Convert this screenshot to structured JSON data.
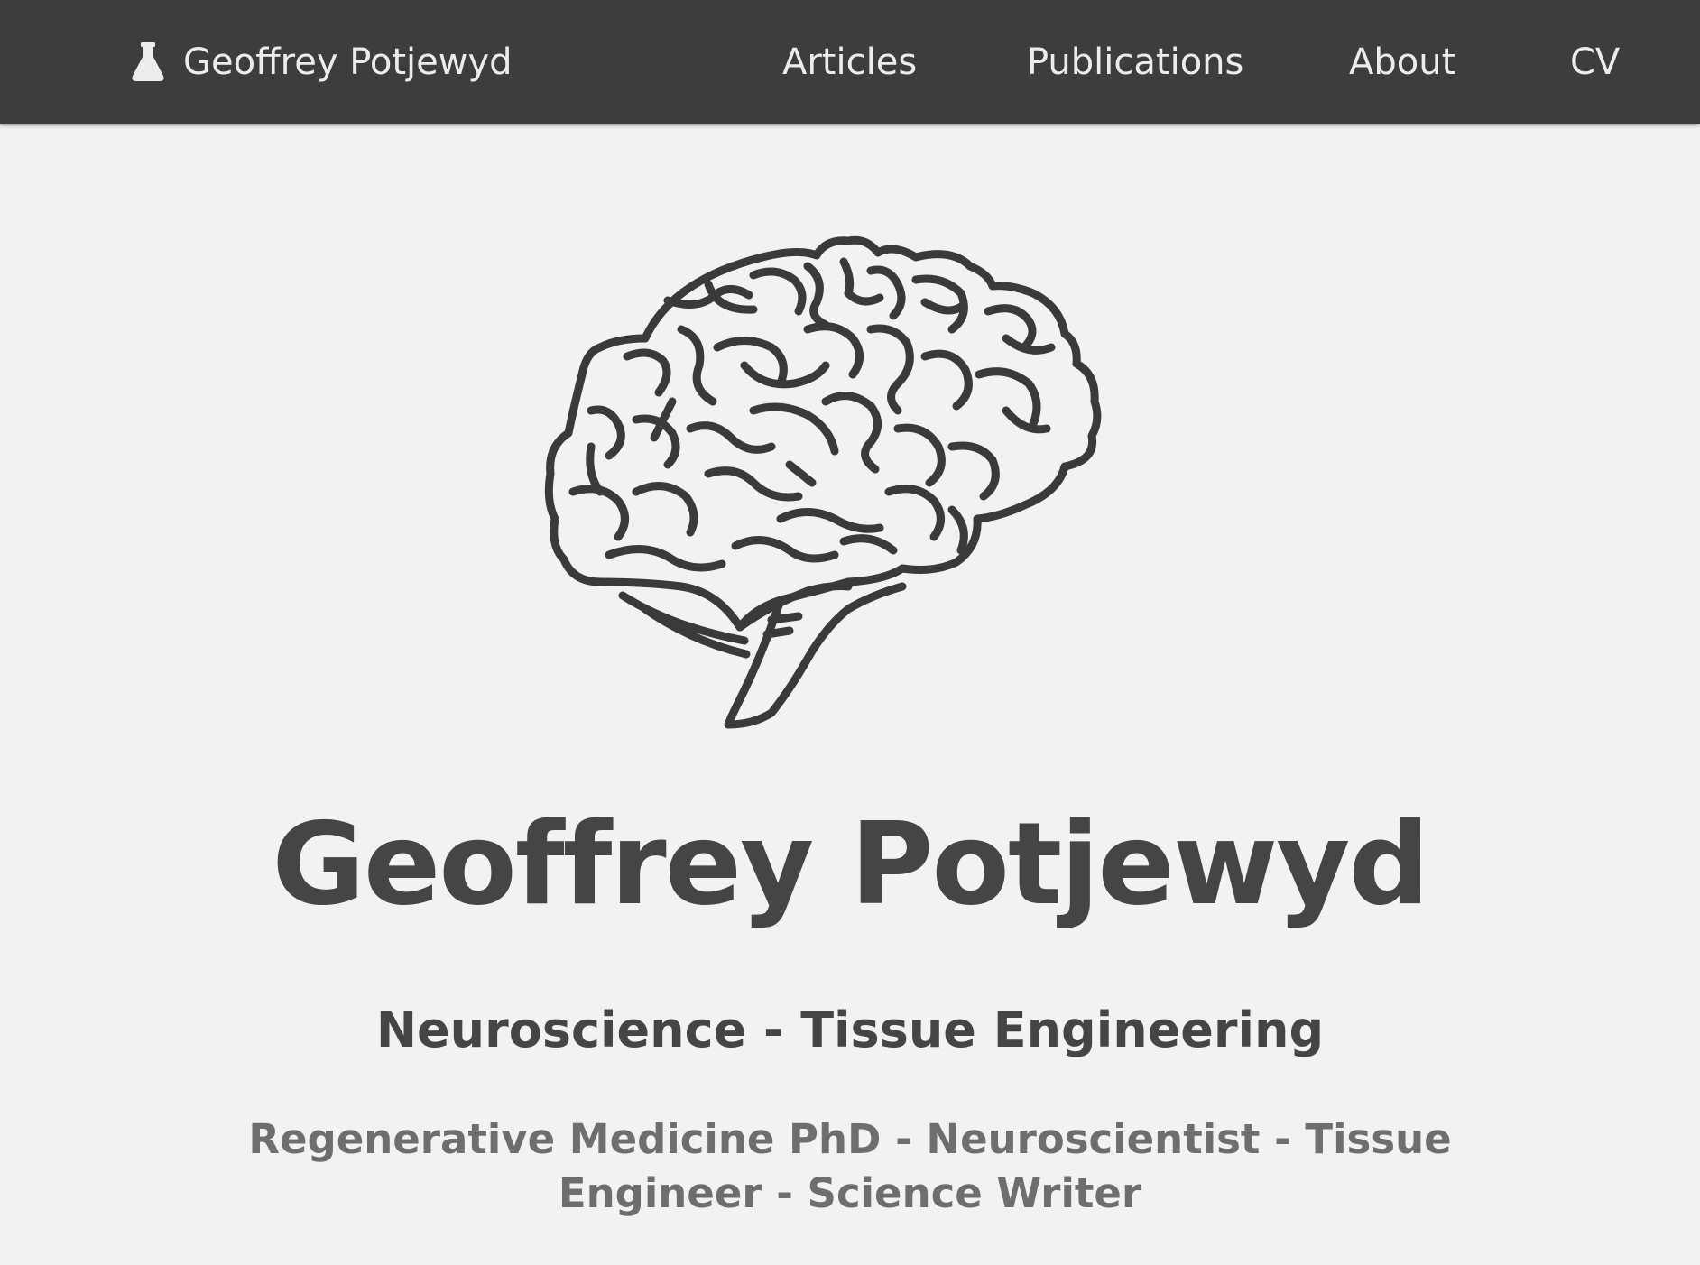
{
  "nav": {
    "brand": "Geoffrey Potjewyd",
    "brand_icon": "flask-icon",
    "links": [
      {
        "label": "Articles"
      },
      {
        "label": "Publications"
      },
      {
        "label": "About"
      },
      {
        "label": "CV"
      }
    ]
  },
  "hero": {
    "logo_icon": "brain-icon",
    "title": "Geoffrey Potjewyd",
    "subtitle": "Neuroscience - Tissue Engineering",
    "tagline": "Regenerative Medicine PhD - Neuroscientist - Tissue Engineer - Science Writer"
  },
  "colors": {
    "navbar_bg": "#3d3d3d",
    "page_bg": "#f2f2f2",
    "text_dark": "#454545",
    "text_muted": "#6e6e6e",
    "nav_text": "#ececec"
  }
}
